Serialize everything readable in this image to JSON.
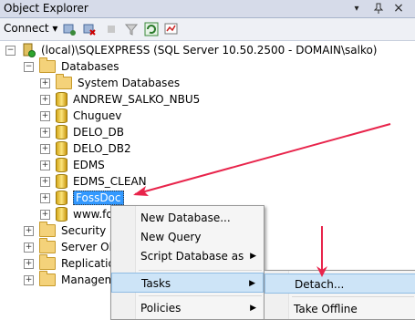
{
  "window": {
    "title": "Object Explorer",
    "pin_glyph": "▾",
    "autohide_glyph": "📌",
    "close_glyph": "×"
  },
  "toolbar": {
    "connect_label": "Connect ▾",
    "icons": [
      "connect-object-explorer-icon",
      "disconnect-icon",
      "stop-icon",
      "filter-icon",
      "refresh-icon",
      "activity-monitor-icon"
    ]
  },
  "tree": {
    "server_label": "(local)\\SQLEXPRESS (SQL Server 10.50.2500 - DOMAIN\\salko)",
    "databases_label": "Databases",
    "db_items": [
      "System Databases",
      "ANDREW_SALKO_NBU5",
      "Chuguev",
      "DELO_DB",
      "DELO_DB2",
      "EDMS",
      "EDMS_CLEAN",
      "FossDoc",
      "www.fo"
    ],
    "other_folders": [
      "Security",
      "Server Obje",
      "Replication",
      "Manageme"
    ]
  },
  "context_menu": {
    "items": [
      "New Database...",
      "New Query",
      "Script Database as",
      "Tasks",
      "Policies"
    ]
  },
  "tasks_submenu": {
    "items": [
      "Detach...",
      "Take Offline"
    ]
  },
  "colors": {
    "selection": "#3399ff",
    "menu_highlight": "#cde4f7",
    "arrow": "#e8244b"
  }
}
